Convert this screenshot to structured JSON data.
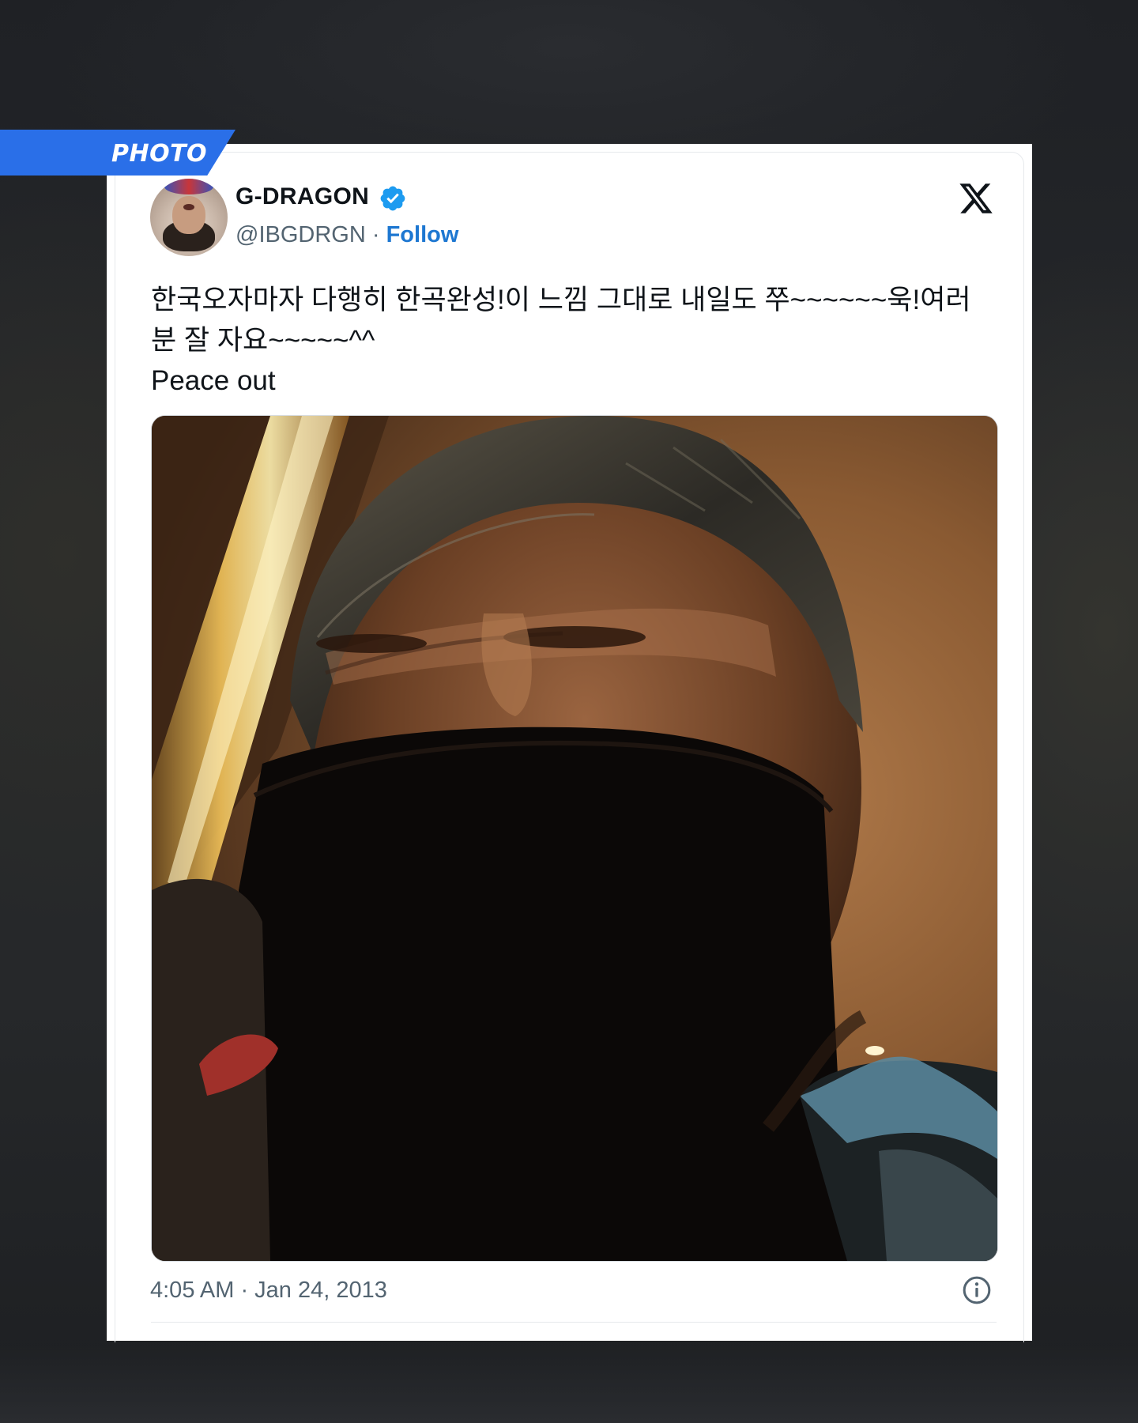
{
  "badge": {
    "label": "PHOTO",
    "color": "#2a6fe8"
  },
  "tweet": {
    "author": {
      "name": "G-DRAGON",
      "handle": "@IBGDRGN",
      "separator": "·",
      "follow_label": "Follow",
      "verified": true,
      "avatar_icon": "profile-photo"
    },
    "platform_icon": "x-logo-icon",
    "text_lines": [
      "한국오자마자 다행히 한곡완성!이 느낌 그대로 내일도 쭈~~~~~~욱!여러",
      "분 잘 자요~~~~~^^",
      "Peace out"
    ],
    "media": {
      "type": "photo",
      "subject": "selfie-with-black-mask"
    },
    "timestamp": "4:05 AM · Jan 24, 2013",
    "info_icon": "info-icon"
  },
  "colors": {
    "follow_blue": "#1d77d1",
    "verified_blue": "#1d9bf0",
    "text_primary": "#0f1419",
    "text_secondary": "#536471"
  }
}
